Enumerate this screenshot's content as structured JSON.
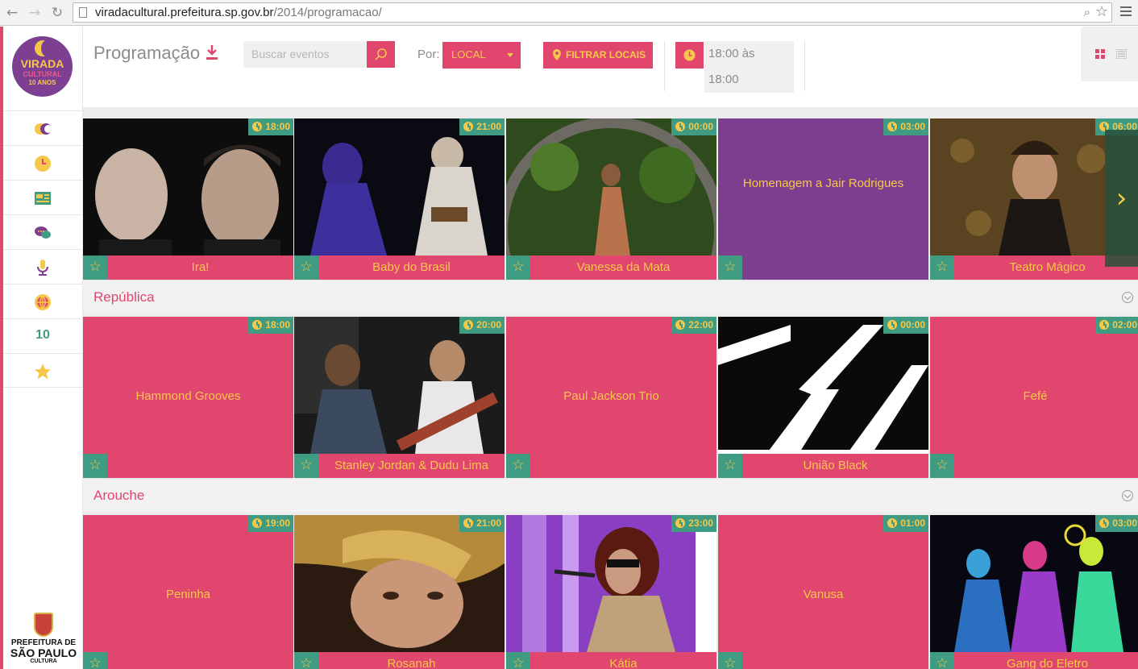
{
  "browser": {
    "url_host": "viradacultural.prefeitura.sp.gov.br",
    "url_path": "/2014/programacao/"
  },
  "logo": {
    "line1": "VIRADA",
    "line2": "CULTURAL",
    "line3": "10 ANOS"
  },
  "sidebar": {
    "items": [
      {
        "icon": "virada-logo-icon"
      },
      {
        "icon": "clock-icon"
      },
      {
        "icon": "news-icon"
      },
      {
        "icon": "chat-icon"
      },
      {
        "icon": "microphone-icon"
      },
      {
        "icon": "globe-icon"
      },
      {
        "icon": "ten-years-icon",
        "label": "10"
      },
      {
        "icon": "star-icon"
      }
    ],
    "footer": {
      "line1": "PREFEITURA DE",
      "line2": "SÃO PAULO",
      "line3": "CULTURA"
    }
  },
  "toolbar": {
    "title": "Programação",
    "search_placeholder": "Buscar eventos",
    "por_label": "Por:",
    "local_select": "LOCAL",
    "filtrar_label": "FILTRAR LOCAIS",
    "time_from": "18:00 às",
    "time_to": "18:00"
  },
  "colors": {
    "accent": "#e0466e",
    "yellow": "#f6c84a",
    "green": "#3f9b82",
    "purple": "#7d3e8f"
  },
  "sections": [
    {
      "title": "",
      "events": [
        {
          "name": "Ira!",
          "time": "18:00"
        },
        {
          "name": "Baby do Brasil",
          "time": "21:00"
        },
        {
          "name": "Vanessa da Mata",
          "time": "00:00"
        },
        {
          "name": "Homenagem a Jair Rodrigues",
          "time": "03:00"
        },
        {
          "name": "Teatro Mágico",
          "time": "06:00"
        }
      ]
    },
    {
      "title": "República",
      "events": [
        {
          "name": "Hammond Grooves",
          "time": "18:00"
        },
        {
          "name": "Stanley Jordan & Dudu Lima",
          "time": "20:00"
        },
        {
          "name": "Paul Jackson Trio",
          "time": "22:00"
        },
        {
          "name": "União Black",
          "time": "00:00"
        },
        {
          "name": "Fefé",
          "time": "02:00"
        }
      ]
    },
    {
      "title": "Arouche",
      "events": [
        {
          "name": "Peninha",
          "time": "19:00"
        },
        {
          "name": "Rosanah",
          "time": "21:00"
        },
        {
          "name": "Kátia",
          "time": "23:00"
        },
        {
          "name": "Vanusa",
          "time": "01:00"
        },
        {
          "name": "Gang do Eletro",
          "time": "03:00"
        }
      ]
    }
  ],
  "status_url": "viradacultural.prefeitura.sp.gov.br/2014/programacao/atracao/41378/"
}
